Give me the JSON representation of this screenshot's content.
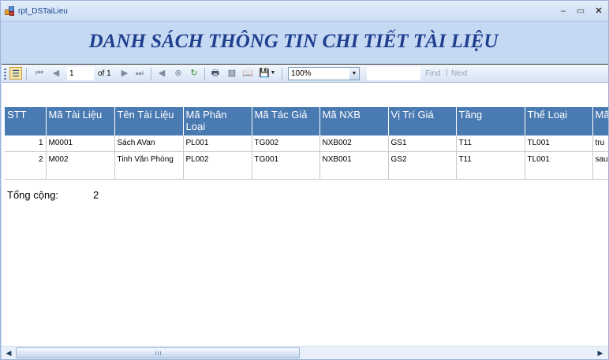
{
  "window": {
    "title": "rpt_DSTaiLieu",
    "minimize": "–",
    "maximize": "▭",
    "close": "✕"
  },
  "report": {
    "title": "DANH SÁCH THÔNG TIN CHI TIẾT TÀI LIỆU"
  },
  "toolbar": {
    "page_current": "1",
    "page_of": "of 1",
    "zoom": "100%",
    "find_value": "",
    "find_label": "Find",
    "find_sep": "|",
    "next_label": "Next",
    "icons": {
      "first": "⏮",
      "prev": "◀",
      "next": "▶",
      "last": "⏭",
      "back": "◀",
      "stop": "⊗",
      "refresh": "↻",
      "print": "🖶",
      "layout": "▤",
      "page_setup": "📖",
      "export": "💾",
      "zoom_dropdown": "▼"
    }
  },
  "table": {
    "columns": [
      "STT",
      "Mã Tài Liệu",
      "Tên Tài Liệu",
      "Mã Phân Loại",
      "Mã Tác Giả",
      "Mã NXB",
      "Vị Trí Giá",
      "Tầng",
      "Thể Loại",
      "Mã"
    ],
    "rows": [
      [
        "1",
        "M0001",
        "Sách AVan",
        "PL001",
        "TG002",
        "NXB002",
        "GS1",
        "T11",
        "TL001",
        "tru"
      ],
      [
        "2",
        "M002",
        "Tinh Văn Phòng",
        "PL002",
        "TG001",
        "NXB001",
        "GS2",
        "T11",
        "TL001",
        "sau"
      ]
    ]
  },
  "summary": {
    "total_label": "Tổng cộng:",
    "total_value": "2"
  },
  "scrollbar": {
    "left_arrow": "◀",
    "right_arrow": "▶"
  }
}
